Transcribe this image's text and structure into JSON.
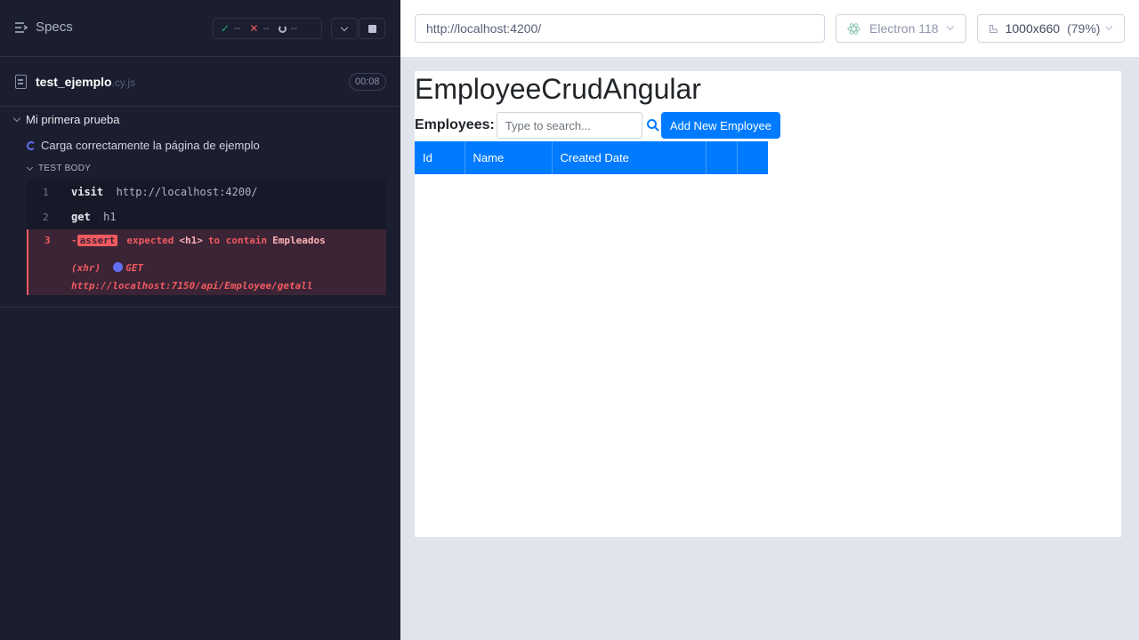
{
  "reporter": {
    "specs_label": "Specs",
    "stats": {
      "passed": "--",
      "failed": "--",
      "pending": "--"
    },
    "spec": {
      "name": "test_ejemplo",
      "ext": ".cy.js",
      "duration": "00:08"
    },
    "suite_title": "Mi primera prueba",
    "test_title": "Carga correctamente la página de ejemplo",
    "test_body_label": "TEST BODY",
    "commands": [
      {
        "num": "1",
        "name": "visit",
        "message": "http://localhost:4200/"
      },
      {
        "num": "2",
        "name": "get",
        "message": "h1"
      }
    ],
    "failed_command": {
      "num": "3",
      "prefix": "-",
      "name": "assert",
      "msg_a": "expected",
      "msg_b": "<h1>",
      "msg_c": "to contain",
      "msg_d": "Empleados",
      "xhr_label": "(xhr)",
      "xhr_method": "GET",
      "xhr_url": "http://localhost:7150/api/Employee/getall"
    }
  },
  "aut": {
    "url": "http://localhost:4200/",
    "browser": "Electron 118",
    "viewport": "1000x660",
    "zoom": "(79%)"
  },
  "app": {
    "title": "EmployeeCrudAngular",
    "employees_label": "Employees:",
    "search_placeholder": "Type to search...",
    "add_button": "Add New Employee",
    "columns": [
      "Id",
      "Name",
      "Created Date",
      "",
      ""
    ]
  },
  "colors": {
    "reporter_bg": "#1b1e2e",
    "fail_red": "#f15a5f",
    "primary_blue": "#007bff",
    "running_indigo": "#6470f3"
  }
}
